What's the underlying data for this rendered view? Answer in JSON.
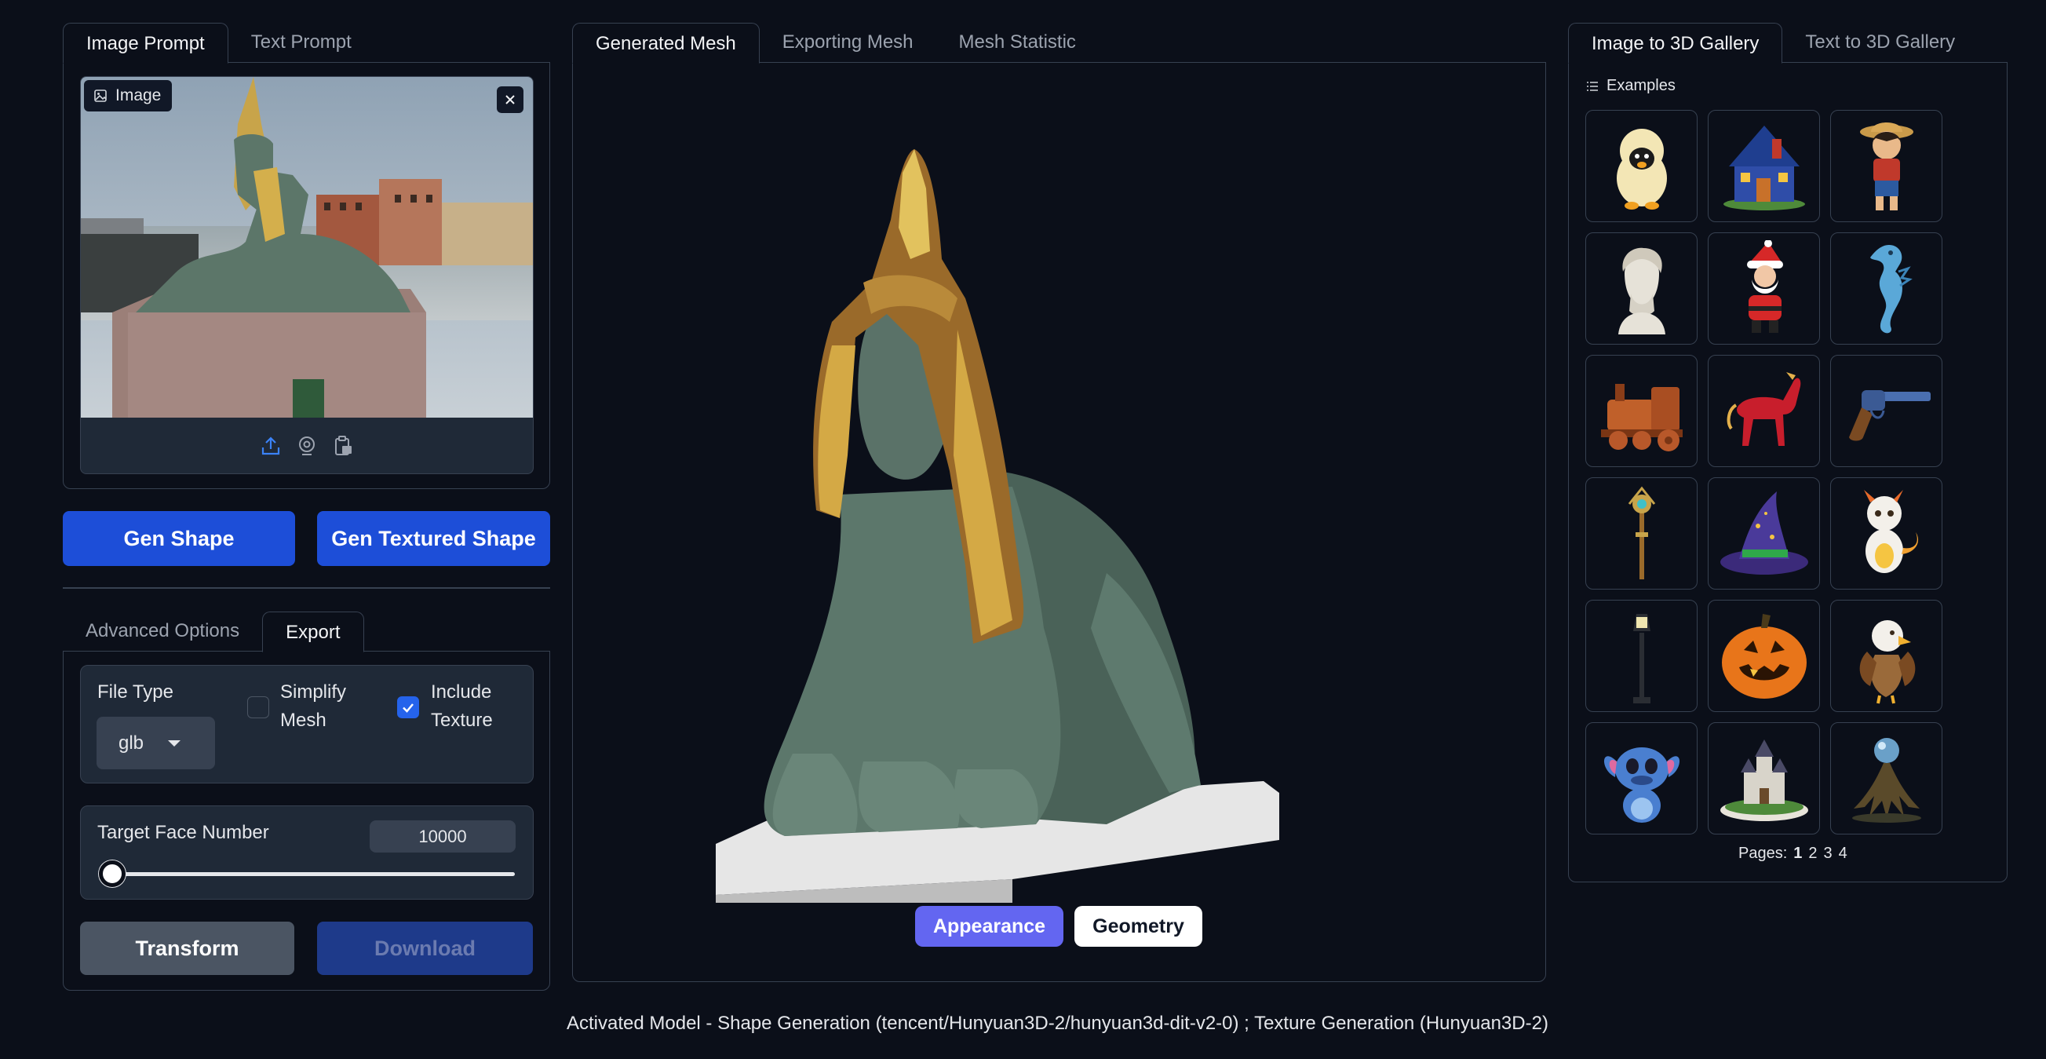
{
  "left_tabs": [
    "Image Prompt",
    "Text Prompt"
  ],
  "image_input": {
    "label": "Image"
  },
  "buttons": {
    "gen_shape": "Gen Shape",
    "gen_textured_shape": "Gen Textured Shape"
  },
  "options_tabs": [
    "Advanced Options",
    "Export"
  ],
  "export": {
    "file_type_label": "File Type",
    "file_type_value": "glb",
    "simplify_mesh_label": "Simplify Mesh",
    "simplify_mesh_checked": false,
    "include_texture_label": "Include Texture",
    "include_texture_checked": true,
    "target_face_label": "Target Face Number",
    "target_face_value": "10000",
    "transform_label": "Transform",
    "download_label": "Download"
  },
  "center_tabs": [
    "Generated Mesh",
    "Exporting Mesh",
    "Mesh Statistic"
  ],
  "viewer": {
    "appearance_label": "Appearance",
    "geometry_label": "Geometry"
  },
  "right_tabs": [
    "Image to 3D Gallery",
    "Text to 3D Gallery"
  ],
  "gallery": {
    "examples_label": "Examples",
    "pages_label": "Pages:",
    "pages": [
      "1",
      "2",
      "3",
      "4"
    ],
    "current_page": "1",
    "items": [
      "penguin",
      "house",
      "pirate-boy",
      "bust",
      "santa",
      "seahorse",
      "train",
      "horse",
      "revolver",
      "staff",
      "wizard-hat",
      "dragon",
      "lamp-post",
      "pumpkin",
      "eagle",
      "alien",
      "castle",
      "tree-orb"
    ]
  },
  "footer": "Activated Model - Shape Generation (tencent/Hunyuan3D-2/hunyuan3d-dit-v2-0) ; Texture Generation (Hunyuan3D-2)",
  "colors": {
    "background": "#0b0f19",
    "primary": "#1d4ed8",
    "appearance": "#6366f1",
    "border": "#374151"
  }
}
